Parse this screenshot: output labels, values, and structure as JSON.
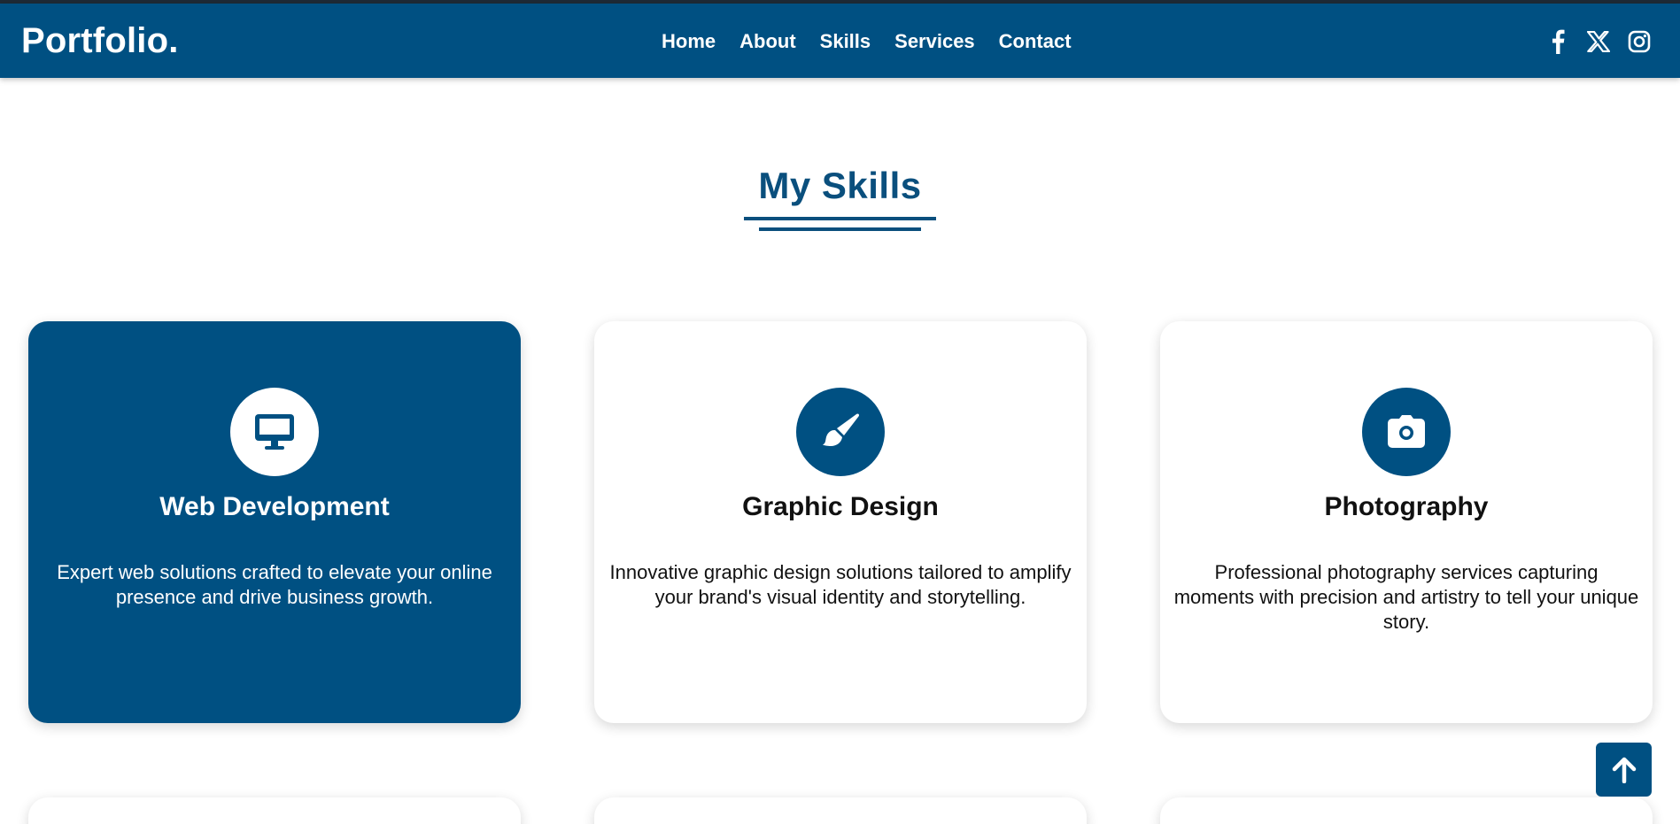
{
  "navbar": {
    "logo": "Portfolio.",
    "links": [
      "Home",
      "About",
      "Skills",
      "Services",
      "Contact"
    ],
    "social": [
      "facebook-icon",
      "x-twitter-icon",
      "instagram-icon"
    ]
  },
  "skills": {
    "title": "My Skills",
    "cards": [
      {
        "icon": "desktop-monitor-icon",
        "title": "Web Development",
        "description": "Expert web solutions crafted to elevate your online presence and drive business growth."
      },
      {
        "icon": "paint-brush-icon",
        "title": "Graphic Design",
        "description": "Innovative graphic design solutions tailored to amplify your brand's visual identity and storytelling."
      },
      {
        "icon": "camera-icon",
        "title": "Photography",
        "description": "Professional photography services capturing moments with precision and artistry to tell your unique story."
      }
    ]
  },
  "back_to_top": {
    "icon": "arrow-up-icon"
  },
  "colors": {
    "brand": "#005082",
    "title": "#0a4f7d",
    "text": "#111111",
    "background": "#ffffff"
  }
}
